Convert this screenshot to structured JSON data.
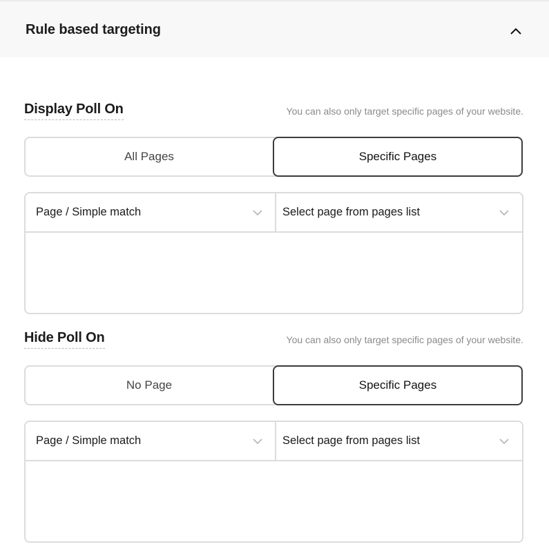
{
  "header": {
    "title": "Rule based targeting",
    "collapse_icon": "chevron-up-icon"
  },
  "display_section": {
    "title": "Display Poll On",
    "hint": "You can also only target specific pages of your website.",
    "options": [
      {
        "label": "All Pages",
        "selected": false
      },
      {
        "label": "Specific Pages",
        "selected": true
      }
    ],
    "rule": {
      "match_type": "Page / Simple match",
      "page_select_placeholder": "Select page from pages list"
    }
  },
  "hide_section": {
    "title": "Hide Poll On",
    "hint": "You can also only target specific pages of your website.",
    "options": [
      {
        "label": "No Page",
        "selected": false
      },
      {
        "label": "Specific Pages",
        "selected": true
      }
    ],
    "rule": {
      "match_type": "Page / Simple match",
      "page_select_placeholder": "Select page from pages list"
    }
  },
  "colors": {
    "header_bg": "#f8f8f8",
    "border": "#dcdcdc",
    "selected_border": "#3b3b3b",
    "hint_text": "#8a8a8a"
  }
}
